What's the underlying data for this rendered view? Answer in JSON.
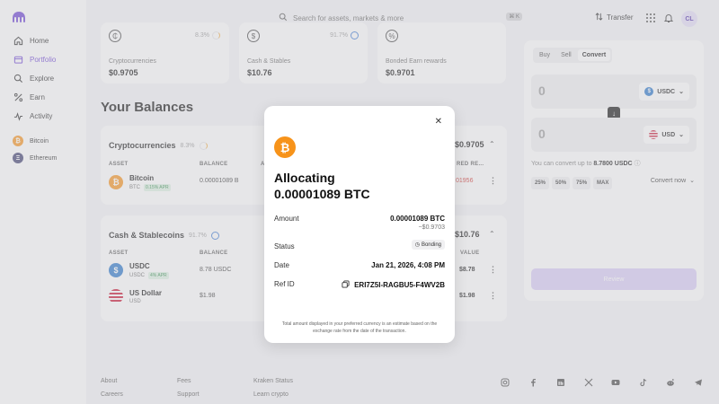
{
  "sidebar": {
    "items": [
      {
        "label": "Home",
        "icon": "home-icon"
      },
      {
        "label": "Portfolio",
        "icon": "portfolio-icon",
        "active": true
      },
      {
        "label": "Explore",
        "icon": "search-icon"
      },
      {
        "label": "Earn",
        "icon": "percent-icon"
      },
      {
        "label": "Activity",
        "icon": "activity-icon"
      }
    ],
    "coins": [
      {
        "label": "Bitcoin",
        "color": "#f7931a",
        "symbol": "₿"
      },
      {
        "label": "Ethereum",
        "color": "#3c3c6e",
        "symbol": "Ξ"
      }
    ]
  },
  "topbar": {
    "search_placeholder": "Search for assets, markets & more",
    "search_shortcut": "⌘ K",
    "transfer_label": "Transfer",
    "avatar_initials": "CL"
  },
  "summary_cards": [
    {
      "symbol": "₵",
      "pct": "8.3%",
      "label": "Cryptocurrencies",
      "value": "$0.9705"
    },
    {
      "symbol": "$",
      "pct": "91.7%",
      "label": "Cash & Stables",
      "value": "$10.76"
    },
    {
      "symbol": "%",
      "pct": "",
      "label": "Bonded Earn rewards",
      "value": "$0.9701"
    }
  ],
  "balances": {
    "title": "Your Balances",
    "crypto": {
      "title": "Cryptocurrencies",
      "pct": "8.3%",
      "total": "$0.9705",
      "col_asset": "ASSET",
      "col_balance": "BALANCE",
      "col_a": "A",
      "col_red": "RED RE...",
      "rows": [
        {
          "name": "Bitcoin",
          "ticker": "BTC",
          "apr": "0.15% APR",
          "balance": "0.00001089 B",
          "reward": "01956"
        }
      ]
    },
    "cash": {
      "title": "Cash & Stablecoins",
      "pct": "91.7%",
      "total": "$10.76",
      "col_asset": "ASSET",
      "col_balance": "BALANCE",
      "col_value": "VALUE",
      "rows": [
        {
          "name": "USDC",
          "ticker": "USDC",
          "apr": "4% APR",
          "balance": "8.78 USDC",
          "value": "$8.78"
        },
        {
          "name": "US Dollar",
          "ticker": "USD",
          "apr": "",
          "balance": "$1.98",
          "value": "$1.98"
        }
      ]
    }
  },
  "trade": {
    "tabs": [
      "Buy",
      "Sell",
      "Convert"
    ],
    "active_tab": "Convert",
    "from_amount": "0",
    "from_currency": "USDC",
    "to_amount": "0",
    "to_currency": "USD",
    "convert_note_prefix": "You can convert up to ",
    "convert_note_amount": "8.7800 USDC",
    "pct_buttons": [
      "25%",
      "50%",
      "75%",
      "MAX"
    ],
    "convert_now": "Convert now",
    "review": "Review"
  },
  "footer": {
    "col1": [
      "About",
      "Careers"
    ],
    "col2": [
      "Fees",
      "Support"
    ],
    "col3": [
      "Kraken Status",
      "Learn crypto"
    ],
    "social_icons": [
      "instagram-icon",
      "facebook-icon",
      "linkedin-icon",
      "x-icon",
      "youtube-icon",
      "tiktok-icon",
      "reddit-icon",
      "telegram-icon"
    ]
  },
  "modal": {
    "title_line1": "Allocating",
    "title_line2": "0.00001089 BTC",
    "amount_label": "Amount",
    "amount_value": "0.00001089 BTC",
    "amount_sub": "~$0.9703",
    "status_label": "Status",
    "status_value": "Bonding",
    "date_label": "Date",
    "date_value": "Jan 21, 2026, 4:08 PM",
    "ref_label": "Ref ID",
    "ref_value": "ERI7Z5I-RAGBU5-F4WV2B",
    "footnote": "Total amount displayed in your preferred currency is an estimate based on the exchange rate from the date of the transaction."
  }
}
